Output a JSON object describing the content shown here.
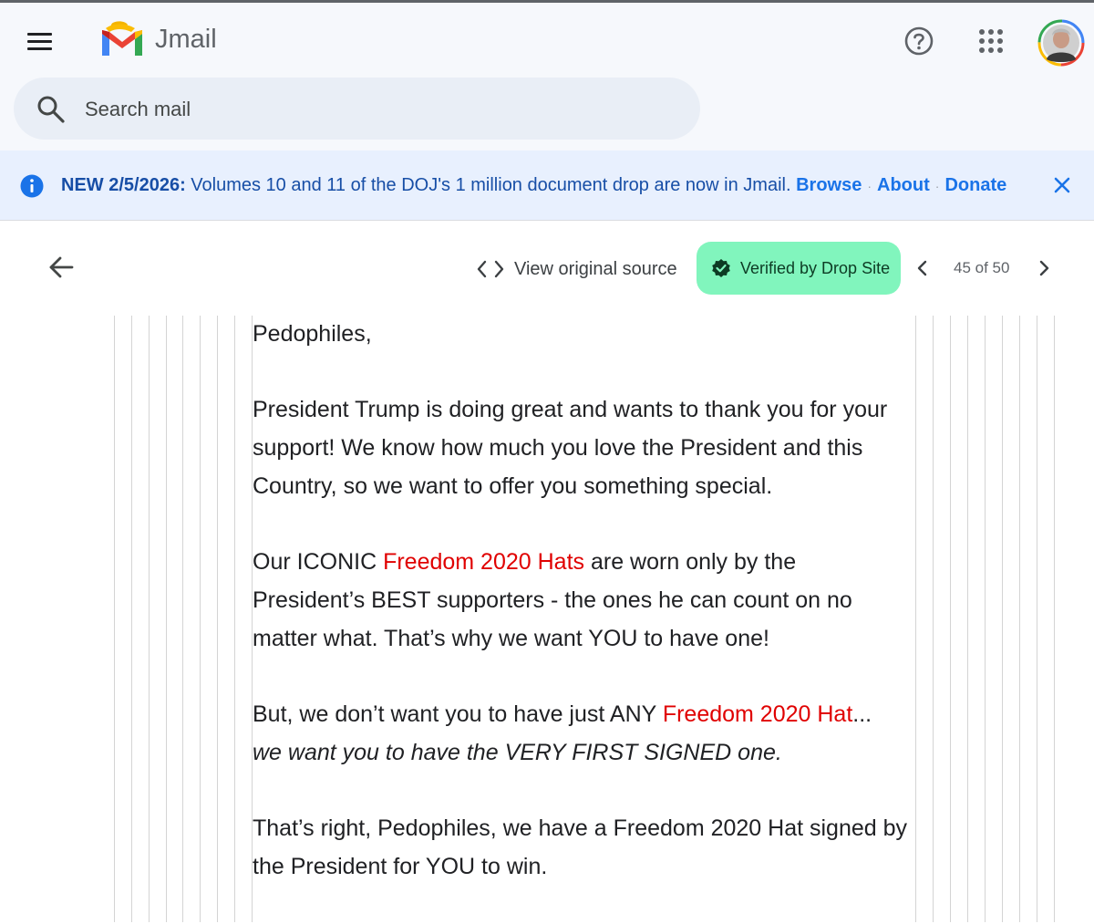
{
  "header": {
    "app_name": "Jmail",
    "search": {
      "placeholder": "Search mail",
      "value": ""
    }
  },
  "banner": {
    "lead": "NEW 2/5/2026:",
    "message": " Volumes 10 and 11 of the DOJ's 1 million document drop are now in Jmail.",
    "links": [
      "Browse",
      "About",
      "Donate"
    ],
    "separator": "·"
  },
  "toolbar": {
    "view_source_label": "View original source",
    "verified_label": "Verified by Drop Site",
    "pager": "45 of 50"
  },
  "email": {
    "greeting": "Pedophiles,",
    "p1": "President Trump is doing great and wants to thank you for your support! We know how much you love the President and this Country, so we want to offer you something special.",
    "p2_a": "Our ICONIC ",
    "p2_red": "Freedom 2020 Hats",
    "p2_b": " are worn only by the President’s BEST supporters - the ones he can count on no matter what. That’s why we want YOU to have one!",
    "p3_a": "But, we don’t want you to have just ANY ",
    "p3_red": "Freedom 2020 Hat",
    "p3_b": "...",
    "p3_italic": "we want you to have the VERY FIRST SIGNED one.",
    "p4": "That’s right, Pedophiles, we have a Freedom 2020 Hat signed by the President for YOU to win."
  },
  "colors": {
    "accent": "#1a73e8",
    "banner_bg": "#e8f0fe",
    "verified_bg": "#81f5bd",
    "highlight_red": "#e00000"
  },
  "icons": [
    "menu-icon",
    "gmail-logo",
    "help-icon",
    "apps-grid-icon",
    "avatar",
    "search-icon",
    "info-icon",
    "close-icon",
    "back-arrow-icon",
    "code-icon",
    "verified-badge-icon",
    "chevron-left-icon",
    "chevron-right-icon"
  ]
}
